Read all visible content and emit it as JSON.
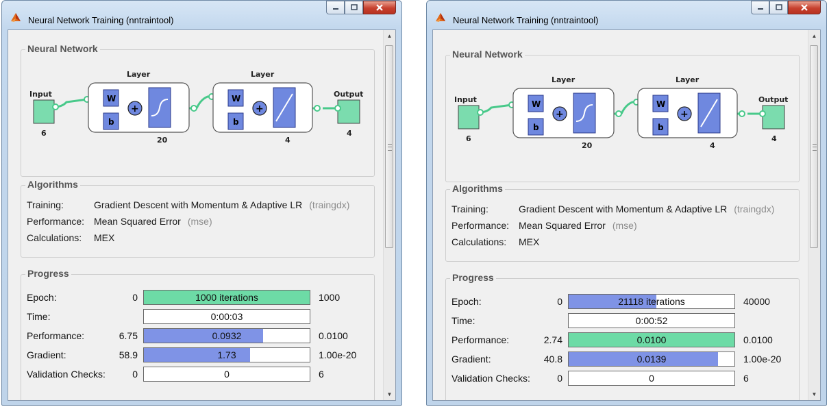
{
  "colors": {
    "green": "#6ddba6",
    "blue": "#7f93e6",
    "node_green": "#7bdcae",
    "block_blue": "#6f88df",
    "line_green": "#48c98a"
  },
  "icons": {
    "app": "matlab-icon",
    "minimize": "minimize-icon",
    "maximize": "maximize-icon",
    "close": "close-icon"
  },
  "windows": [
    {
      "title": "Neural Network Training (nntraintool)",
      "network": {
        "heading": "Neural Network",
        "input_label": "Input",
        "input_size": "6",
        "layer1_label": "Layer",
        "layer1_size": "20",
        "layer2_label": "Layer",
        "layer2_size": "4",
        "output_label": "Output",
        "output_size": "4",
        "w": "W",
        "b": "b",
        "plus": "+"
      },
      "algorithms": {
        "heading": "Algorithms",
        "training_label": "Training:",
        "training_value": "Gradient Descent with Momentum & Adaptive LR",
        "training_code": "(traingdx)",
        "performance_label": "Performance:",
        "performance_value": "Mean Squared Error",
        "performance_code": "(mse)",
        "calculations_label": "Calculations:",
        "calculations_value": "MEX"
      },
      "progress": {
        "heading": "Progress",
        "rows": [
          {
            "label": "Epoch:",
            "start": "0",
            "bar_text": "1000 iterations",
            "end": "1000",
            "fill": 1.0,
            "color": "green"
          },
          {
            "label": "Time:",
            "start": "",
            "bar_text": "0:00:03",
            "end": "",
            "fill": 0,
            "color": "blue"
          },
          {
            "label": "Performance:",
            "start": "6.75",
            "bar_text": "0.0932",
            "end": "0.0100",
            "fill": 0.72,
            "color": "blue"
          },
          {
            "label": "Gradient:",
            "start": "58.9",
            "bar_text": "1.73",
            "end": "1.00e-20",
            "fill": 0.64,
            "color": "blue"
          },
          {
            "label": "Validation Checks:",
            "start": "0",
            "bar_text": "0",
            "end": "6",
            "fill": 0,
            "color": "blue"
          }
        ]
      }
    },
    {
      "title": "Neural Network Training (nntraintool)",
      "network": {
        "heading": "Neural Network",
        "input_label": "Input",
        "input_size": "6",
        "layer1_label": "Layer",
        "layer1_size": "20",
        "layer2_label": "Layer",
        "layer2_size": "4",
        "output_label": "Output",
        "output_size": "4",
        "w": "W",
        "b": "b",
        "plus": "+"
      },
      "algorithms": {
        "heading": "Algorithms",
        "training_label": "Training:",
        "training_value": "Gradient Descent with Momentum & Adaptive LR",
        "training_code": "(traingdx)",
        "performance_label": "Performance:",
        "performance_value": "Mean Squared Error",
        "performance_code": "(mse)",
        "calculations_label": "Calculations:",
        "calculations_value": "MEX"
      },
      "progress": {
        "heading": "Progress",
        "rows": [
          {
            "label": "Epoch:",
            "start": "0",
            "bar_text": "21118 iterations",
            "end": "40000",
            "fill": 0.53,
            "color": "blue"
          },
          {
            "label": "Time:",
            "start": "",
            "bar_text": "0:00:52",
            "end": "",
            "fill": 0,
            "color": "blue"
          },
          {
            "label": "Performance:",
            "start": "2.74",
            "bar_text": "0.0100",
            "end": "0.0100",
            "fill": 1.0,
            "color": "green"
          },
          {
            "label": "Gradient:",
            "start": "40.8",
            "bar_text": "0.0139",
            "end": "1.00e-20",
            "fill": 0.9,
            "color": "blue"
          },
          {
            "label": "Validation Checks:",
            "start": "0",
            "bar_text": "0",
            "end": "6",
            "fill": 0,
            "color": "blue"
          }
        ]
      }
    }
  ]
}
